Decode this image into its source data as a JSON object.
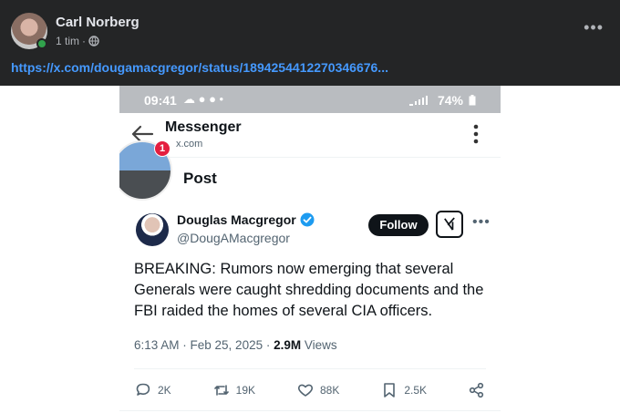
{
  "facebook_post": {
    "author": "Carl Norberg",
    "time": "1 tim",
    "separator": "·",
    "link": "https://x.com/dougamacgregor/status/1894254412270346676..."
  },
  "status_bar": {
    "time": "09:41",
    "icons_left": "☁ ● ● •",
    "battery": "74%"
  },
  "app_bar": {
    "title": "Messenger",
    "subtitle": "x.com"
  },
  "post_header": {
    "title": "Post",
    "badge_count": "1"
  },
  "tweet": {
    "author_name": "Douglas Macgregor",
    "handle": "@DougAMacgregor",
    "follow_label": "Follow",
    "text": "BREAKING: Rumors now emerging that several Generals were caught shredding documents and the FBI raided the homes of several CIA officers.",
    "timestamp": "6:13 AM · Feb 25, 2025 · ",
    "views_count": "2.9M",
    "views_label": " Views",
    "replies": "2K",
    "reposts": "19K",
    "likes": "88K",
    "bookmarks": "2.5K"
  },
  "colors": {
    "fb_bg": "#242526",
    "fb_link": "#4599ff",
    "x_text": "#0f1419",
    "x_muted": "#536471",
    "verified": "#1d9bf0"
  }
}
